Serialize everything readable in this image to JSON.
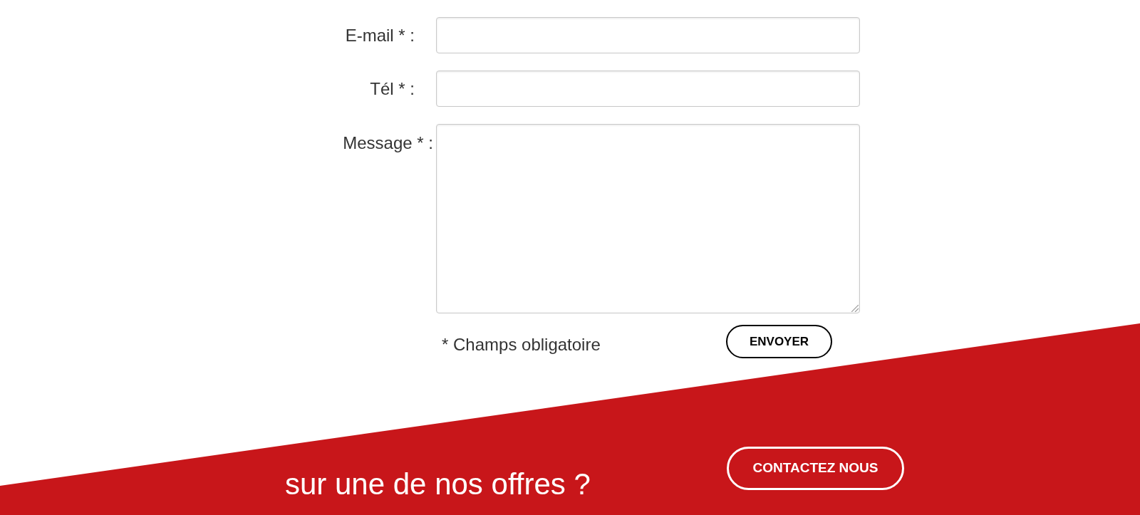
{
  "form": {
    "fields": [
      {
        "kind": "input",
        "label": "E-mail * :"
      },
      {
        "kind": "input",
        "label": "Tél * :"
      },
      {
        "kind": "textarea",
        "label": "Message * :"
      }
    ],
    "required_note": "* Champs obligatoire",
    "submit_button": "ENVOYER"
  },
  "cta_banner": {
    "text": "sur une de nos offres ?",
    "button": "CONTACTEZ NOUS"
  }
}
